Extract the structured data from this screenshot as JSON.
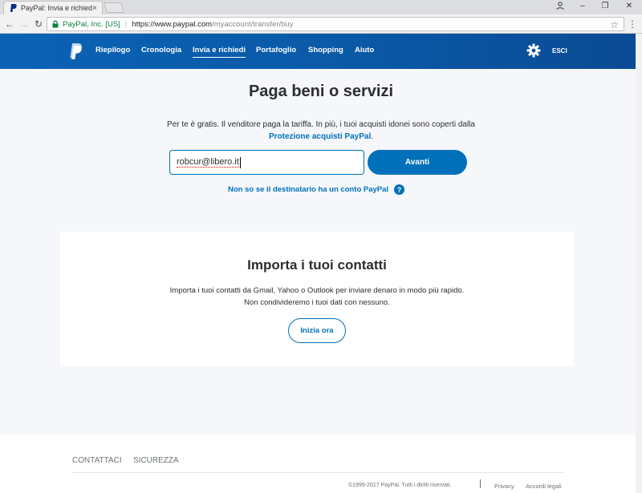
{
  "browser": {
    "tab_title": "PayPal: Invia e richiedi",
    "tab_close": "×",
    "url_org": "PayPal, Inc. [US]",
    "url_host": "https://www.paypal.com",
    "url_path": "/myaccount/transfer/buy"
  },
  "nav": {
    "items": [
      "Riepilogo",
      "Cronologia",
      "Invia e richiedi",
      "Portafoglio",
      "Shopping",
      "Aiuto"
    ],
    "active": "Invia e richiedi",
    "logout": "ESCI"
  },
  "main": {
    "title": "Paga beni o servizi",
    "info_line1": "Per te è gratis. Il venditore paga la tariffa. In più, i tuoi acquisti idonei sono coperti dalla",
    "info_link": "Protezione acquisti PayPal",
    "info_end": ".",
    "recipient_value": "robcur@libero.it",
    "next_button": "Avanti",
    "unknown_link": "Non so se il destinatario ha un conto PayPal",
    "help": "?"
  },
  "contacts": {
    "title": "Importa i tuoi contatti",
    "line1": "Importa i tuoi contatti da Gmail, Yahoo o Outlook per inviare denaro in modo più rapido.",
    "line2": "Non condivideremo i tuoi dati con nessuno.",
    "button": "Inizia ora"
  },
  "footer": {
    "contact": "CONTATTACI",
    "security": "SICUREZZA",
    "copyright": "©1999-2017 PayPal. Tutti i diritti riservati.",
    "privacy": "Privacy",
    "legal": "Accordi legali"
  },
  "colors": {
    "brand_blue": "#0070ba",
    "header_dark": "#0b4a94",
    "background": "#f5f7fa"
  }
}
